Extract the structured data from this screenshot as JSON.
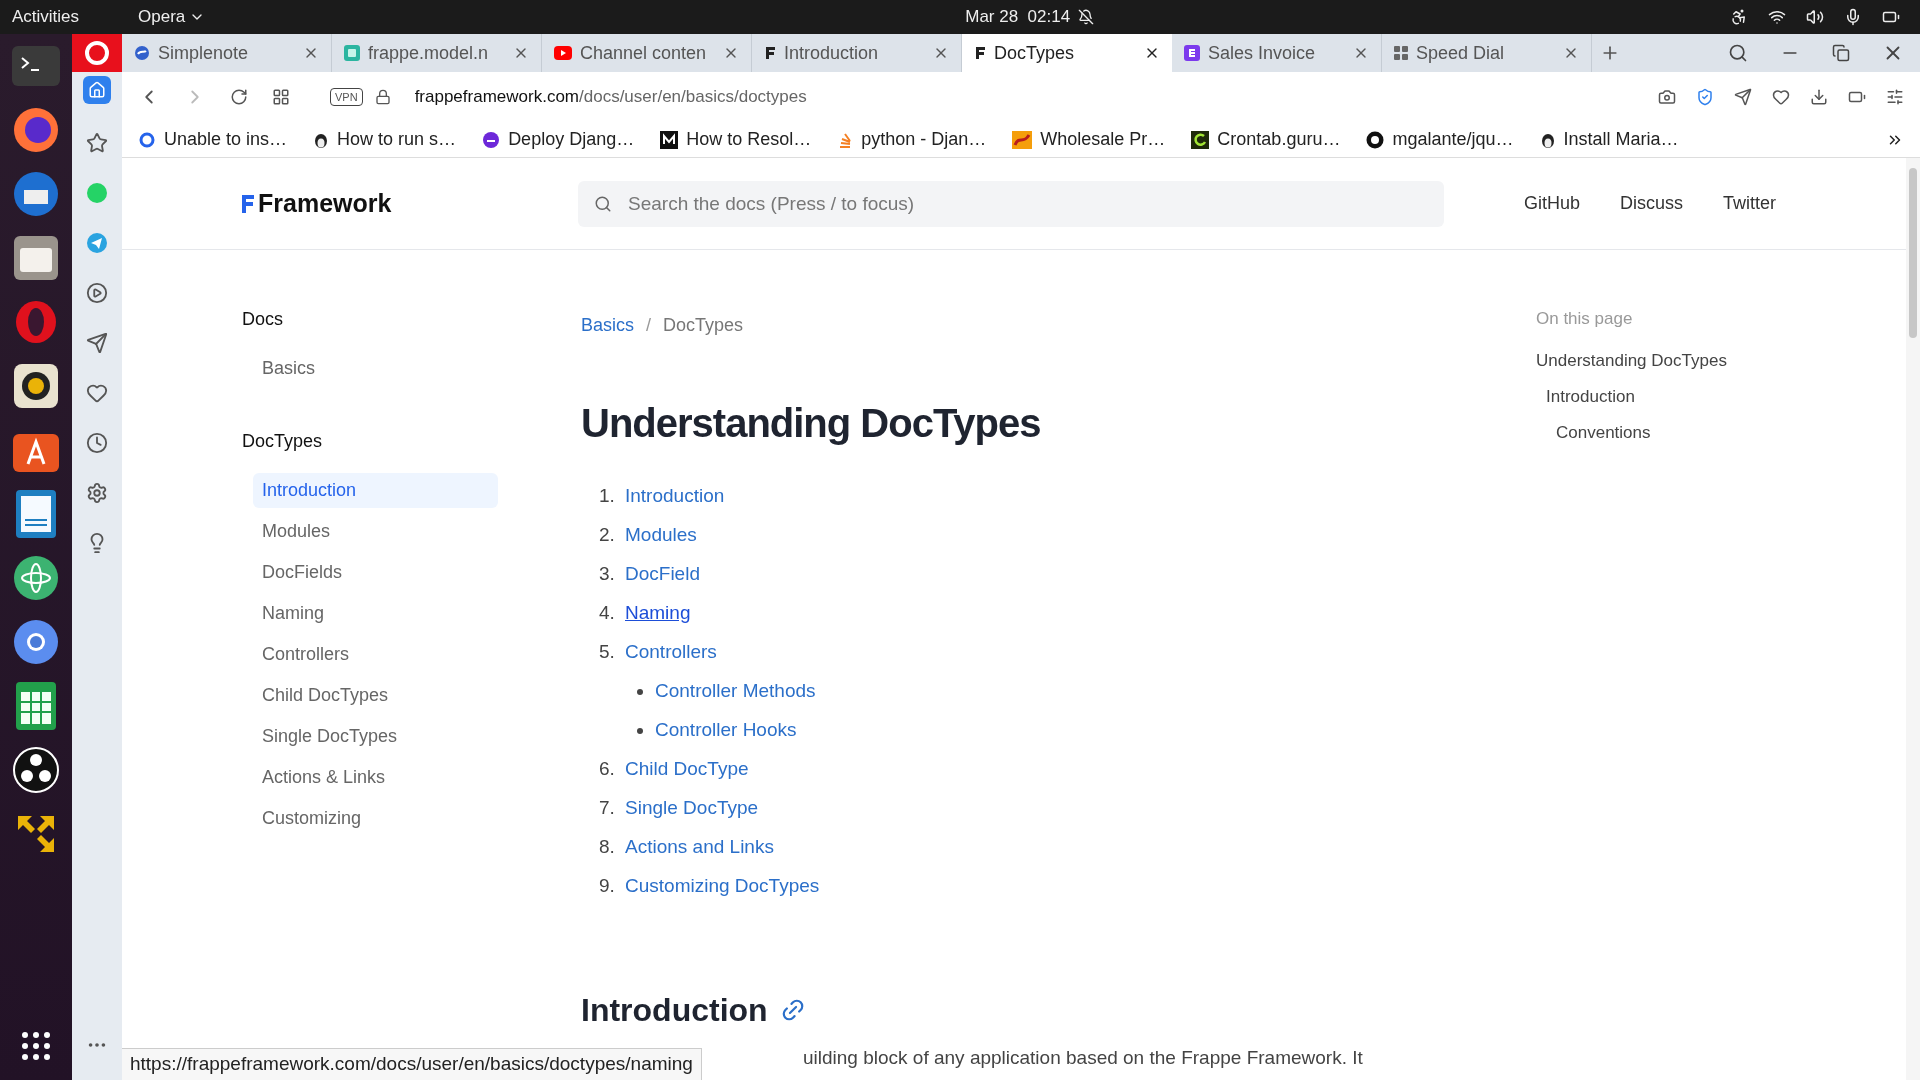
{
  "top_bar": {
    "activities": "Activities",
    "app": "Opera",
    "clock": "Mar 28  02:14"
  },
  "tabs": [
    {
      "title": "Simplenote",
      "kind": "simplenote",
      "selected": false
    },
    {
      "title": "frappe.model.n",
      "kind": "frappe",
      "selected": false
    },
    {
      "title": "Channel conten",
      "kind": "youtube",
      "selected": false
    },
    {
      "title": "Introduction",
      "kind": "framework",
      "selected": false
    },
    {
      "title": "DocTypes",
      "kind": "framework",
      "selected": true
    },
    {
      "title": "Sales Invoice",
      "kind": "erpnext",
      "selected": false
    },
    {
      "title": "Speed Dial",
      "kind": "speeddial",
      "selected": false
    }
  ],
  "address": {
    "vpn": "VPN",
    "domain": "frappeframework.com",
    "path": "/docs/user/en/basics/doctypes"
  },
  "bookmarks": [
    {
      "label": "Unable to ins…",
      "kind": "ring"
    },
    {
      "label": "How to run s…",
      "kind": "penguin"
    },
    {
      "label": "Deploy Djang…",
      "kind": "purple"
    },
    {
      "label": "How to Resol…",
      "kind": "medium"
    },
    {
      "label": "python - Djan…",
      "kind": "stack"
    },
    {
      "label": "Wholesale Pr…",
      "kind": "orange"
    },
    {
      "label": "Crontab.guru…",
      "kind": "crontab"
    },
    {
      "label": "mgalante/jqu…",
      "kind": "github"
    },
    {
      "label": "Install Maria…",
      "kind": "penguin"
    }
  ],
  "site_header": {
    "logo": "Framework",
    "search_placeholder": "Search the docs (Press / to focus)",
    "links": [
      "GitHub",
      "Discuss",
      "Twitter"
    ]
  },
  "sidebar": [
    {
      "title": "Docs",
      "items": [
        {
          "label": "Basics",
          "selected": false
        }
      ]
    },
    {
      "title": "DocTypes",
      "items": [
        {
          "label": "Introduction",
          "selected": true
        },
        {
          "label": "Modules",
          "selected": false
        },
        {
          "label": "DocFields",
          "selected": false
        },
        {
          "label": "Naming",
          "selected": false
        },
        {
          "label": "Controllers",
          "selected": false
        },
        {
          "label": "Child DocTypes",
          "selected": false
        },
        {
          "label": "Single DocTypes",
          "selected": false
        },
        {
          "label": "Actions & Links",
          "selected": false
        },
        {
          "label": "Customizing",
          "selected": false
        }
      ]
    }
  ],
  "breadcrumb": [
    {
      "label": "Basics",
      "link": true
    },
    {
      "label": "DocTypes",
      "link": false
    }
  ],
  "breadcrumb_separator": "/",
  "title": "Understanding DocTypes",
  "contents": [
    {
      "number": "1.",
      "label": "Introduction",
      "hovered": false
    },
    {
      "number": "2.",
      "label": "Modules",
      "hovered": false
    },
    {
      "number": "3.",
      "label": "DocField",
      "hovered": false
    },
    {
      "number": "4.",
      "label": "Naming",
      "hovered": true
    },
    {
      "number": "5.",
      "label": "Controllers",
      "hovered": false,
      "children": [
        {
          "label": "Controller Methods"
        },
        {
          "label": "Controller Hooks"
        }
      ]
    },
    {
      "number": "6.",
      "label": "Child DocType",
      "hovered": false
    },
    {
      "number": "7.",
      "label": "Single DocType",
      "hovered": false
    },
    {
      "number": "8.",
      "label": "Actions and Links",
      "hovered": false
    },
    {
      "number": "9.",
      "label": "Customizing DocTypes",
      "hovered": false
    }
  ],
  "section_heading": "Introduction",
  "body_text": "uilding block of any application based on the Frappe Framework. It",
  "toc": {
    "title": "On this page",
    "items": [
      {
        "label": "Understanding DocTypes",
        "children": [
          {
            "label": "Introduction",
            "children": [
              {
                "label": "Conventions"
              }
            ]
          }
        ]
      }
    ]
  },
  "status_url": "https://frappeframework.com/docs/user/en/basics/doctypes/naming"
}
